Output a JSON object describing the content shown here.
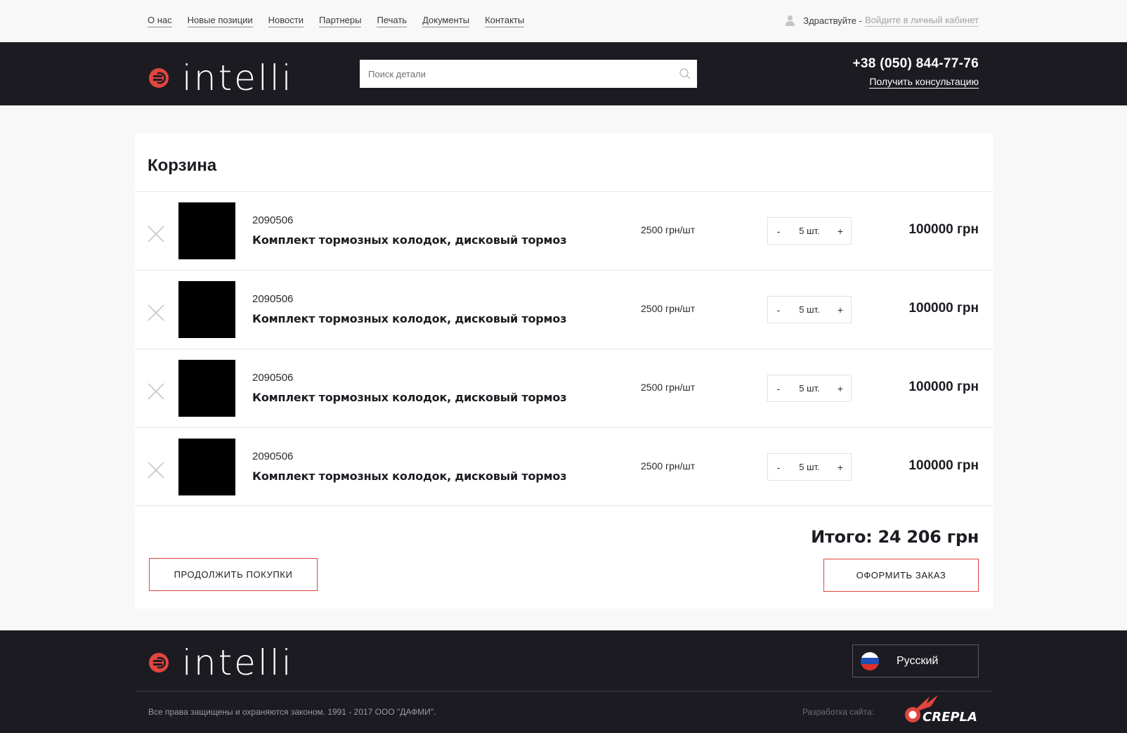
{
  "topnav": {
    "items": [
      "О нас",
      "Новые позиции",
      "Новости",
      "Партнеры",
      "Печать",
      "Документы",
      "Контакты"
    ],
    "greeting": "Здраствуйте -",
    "login_link": "Войдите в личный кабинет"
  },
  "header": {
    "logo_text": "intelli",
    "search_placeholder": "Поиск детали",
    "phone": "+38 (050) 844-77-76",
    "consult_link": "Получить консультацию"
  },
  "cart": {
    "title": "Корзина",
    "items": [
      {
        "sku": "2090506",
        "name": "Комплект тормозных колодок, дисковый тормоз",
        "unit_price": "2500 грн/шт",
        "qty": "5 шт.",
        "total": "100000 грн"
      },
      {
        "sku": "2090506",
        "name": "Комплект тормозных колодок, дисковый тормоз",
        "unit_price": "2500 грн/шт",
        "qty": "5 шт.",
        "total": "100000 грн"
      },
      {
        "sku": "2090506",
        "name": "Комплект тормозных колодок, дисковый тормоз",
        "unit_price": "2500 грн/шт",
        "qty": "5 шт.",
        "total": "100000 грн"
      },
      {
        "sku": "2090506",
        "name": "Комплект тормозных колодок, дисковый тормоз",
        "unit_price": "2500 грн/шт",
        "qty": "5 шт.",
        "total": "100000 грн"
      }
    ],
    "qty_minus": "-",
    "qty_plus": "+",
    "grand_total": "Итого: 24 206 грн",
    "continue_label": "Продолжить покупки",
    "checkout_label": "Оформить заказ"
  },
  "footer": {
    "logo_text": "intelli",
    "language": "Русский",
    "copyright": "Все права защищены и охраняются законом. 1991 - 2017 ООО \"ДАФМИ\".",
    "dev_label": "Разработка сайта:",
    "dev_brand": "CREPLA"
  },
  "colors": {
    "accent": "#e0463f",
    "dark": "#1c1b21"
  }
}
